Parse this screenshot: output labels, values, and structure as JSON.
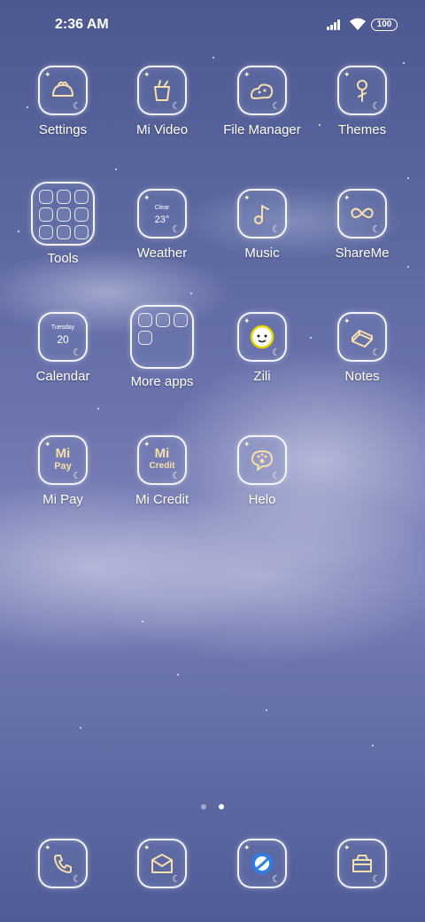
{
  "status_bar": {
    "time": "2:36 AM",
    "battery": "100"
  },
  "apps": [
    {
      "id": "settings",
      "label": "Settings",
      "icon": "bun-icon"
    },
    {
      "id": "mi-video",
      "label": "Mi Video",
      "icon": "video-cup-icon"
    },
    {
      "id": "file-manager",
      "label": "File Manager",
      "icon": "folder-cloud-icon"
    },
    {
      "id": "themes",
      "label": "Themes",
      "icon": "brush-icon"
    },
    {
      "id": "tools",
      "label": "Tools",
      "icon": "folder-grid-icon"
    },
    {
      "id": "weather",
      "label": "Weather",
      "icon": "weather-icon",
      "condition": "Clear",
      "temp": "23°"
    },
    {
      "id": "music",
      "label": "Music",
      "icon": "music-note-icon"
    },
    {
      "id": "shareme",
      "label": "ShareMe",
      "icon": "infinity-icon"
    },
    {
      "id": "calendar",
      "label": "Calendar",
      "icon": "calendar-icon",
      "day": "Tuesday",
      "date": "20"
    },
    {
      "id": "more-apps",
      "label": "More apps",
      "icon": "folder-grid-icon"
    },
    {
      "id": "zili",
      "label": "Zili",
      "icon": "zili-face-icon"
    },
    {
      "id": "notes",
      "label": "Notes",
      "icon": "notes-icon"
    },
    {
      "id": "mi-pay",
      "label": "Mi Pay",
      "icon": "mi-pay-icon",
      "text": "Pay"
    },
    {
      "id": "mi-credit",
      "label": "Mi Credit",
      "icon": "mi-credit-icon",
      "text": "Credit"
    },
    {
      "id": "helo",
      "label": "Helo",
      "icon": "paw-bubble-icon"
    }
  ],
  "dock": [
    {
      "id": "phone",
      "icon": "phone-icon"
    },
    {
      "id": "messages",
      "icon": "envelope-icon"
    },
    {
      "id": "browser",
      "icon": "browser-icon"
    },
    {
      "id": "camera",
      "icon": "camera-icon"
    }
  ],
  "page_indicator": {
    "pages": 2,
    "current": 2
  },
  "colors": {
    "icon_gold": "#f6dfaa",
    "tile_border": "#ffffff"
  }
}
